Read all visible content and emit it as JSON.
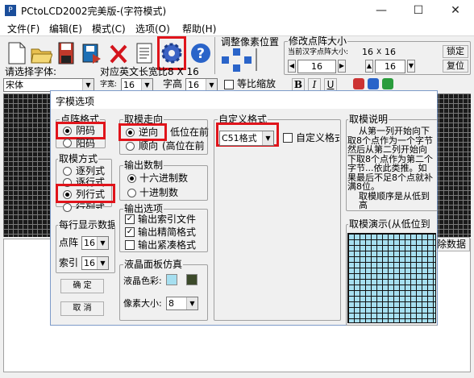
{
  "window": {
    "title": "PCtoLCD2002完美版-(字符模式)",
    "minimize": "—",
    "maximize": "☐",
    "close": "✕"
  },
  "menu": [
    "文件(F)",
    "编辑(E)",
    "模式(C)",
    "选项(O)",
    "帮助(H)"
  ],
  "toolbar": {
    "pixel_adjust_title": "调整像素位置",
    "matrix_size_title": "修改点阵大小",
    "current_size_label": "当前汉字点阵大小:",
    "current_width": "16",
    "current_x": "X",
    "current_height": "16",
    "width_spin": "16",
    "height_spin": "16",
    "lock_button": "锁定",
    "restore_button": "复位"
  },
  "font_row": {
    "select_font_label": "请选择字体:",
    "font_value": "宋体",
    "ascii_width_label": "对应英文长宽比",
    "ascii_size_text": "8 X 16",
    "char_width_label": "字宽:",
    "char_width_value": "16",
    "char_height_label": "字高",
    "char_height_value": "16",
    "scale_label": "等比缩放",
    "bold": "B",
    "italic": "I",
    "underline": "U"
  },
  "bottom": {
    "clear_button": "除数据"
  },
  "dialog": {
    "title": "字模选项",
    "dot_format": {
      "title": "点阵格式",
      "options": [
        "阴码",
        "阳码"
      ],
      "selected": 0
    },
    "mode": {
      "title": "取模方式",
      "options": [
        "逐列式",
        "逐行式",
        "列行式",
        "行列式"
      ],
      "selected": 2
    },
    "per_line": {
      "title": "每行显示数据",
      "dot_label": "点阵",
      "dot_value": "16",
      "index_label": "索引",
      "index_value": "16"
    },
    "direction": {
      "title": "取模走向",
      "options": [
        "逆向",
        "顺向"
      ],
      "hints": [
        "低位在前",
        "(高位在前"
      ],
      "selected": 0
    },
    "number_format": {
      "title": "输出数制",
      "options": [
        "十六进制数",
        "十进制数"
      ],
      "selected": 0
    },
    "output_options": {
      "title": "输出选项",
      "items": [
        "输出索引文件",
        "输出精简格式",
        "输出紧凑格式"
      ],
      "checked": [
        true,
        true,
        false
      ]
    },
    "lcd_sim": {
      "title": "液晶面板仿真",
      "color_label": "液晶色彩:",
      "pixel_size_label": "像素大小:",
      "pixel_size_value": "8",
      "colors": {
        "fg": "#a6dff0",
        "bg": "#3c4a2a"
      }
    },
    "custom_format": {
      "title": "自定义格式",
      "value": "C51格式",
      "custom_check_label": "自定义格式"
    },
    "explanation": {
      "title": "取模说明",
      "lines": [
        "从第一列开始向下",
        "取8个点作为一个字节",
        "然后从第二列开始向",
        "下取8个点作为第二个",
        "字节...依此类推。如",
        "果最后不足8个点就补",
        "满8位。",
        "取模顺序是从低到高"
      ]
    },
    "demo": {
      "title": "取模演示(从低位到"
    },
    "ok_button": "确  定",
    "cancel_button": "取  消"
  }
}
